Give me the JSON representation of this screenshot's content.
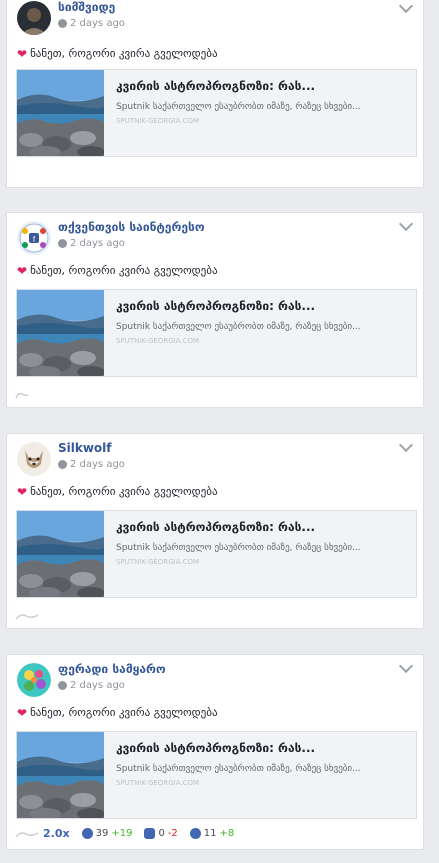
{
  "posts": [
    {
      "author": "სიმშვიდე",
      "time": "2 days ago",
      "text": "ნანეთ, როგორი კვირა გველოდება",
      "link": {
        "title": "კვირის ასტროპროგნოზი: რას...",
        "description": "Sputnik საქართველო ესაუბრობთ იმაზე, რაზეც სხვები...",
        "domain": "SPUTNIK-GEORGIA.COM"
      }
    },
    {
      "author": "თქვენთვის საინტერესო",
      "time": "2 days ago",
      "text": "ნანეთ, როგორი კვირა გველოდება",
      "link": {
        "title": "კვირის ასტროპროგნოზი: რას...",
        "description": "Sputnik საქართველო ესაუბრობთ იმაზე, რაზეც სხვები...",
        "domain": "SPUTNIK-GEORGIA.COM"
      }
    },
    {
      "author": "Silkwolf",
      "time": "2 days ago",
      "text": "ნანეთ, როგორი კვირა გველოდება",
      "link": {
        "title": "კვირის ასტროპროგნოზი: რას...",
        "description": "Sputnik საქართველო ესაუბრობთ იმაზე, რაზეც სხვები...",
        "domain": "SPUTNIK-GEORGIA.COM"
      }
    },
    {
      "author": "ფერადი სამყარო",
      "time": "2 days ago",
      "text": "ნანეთ, როგორი კვირა გველოდება",
      "link": {
        "title": "კვირის ასტროპროგნოზი: რას...",
        "description": "Sputnik საქართველო ესაუბრობთ იმაზე, რაზეც სხვები...",
        "domain": "SPUTNIK-GEORGIA.COM"
      },
      "stats": {
        "multiplier": "2.0x",
        "reactions": "39",
        "reactions_delta": "+19",
        "comments": "0",
        "comments_delta": "-2",
        "shares": "11",
        "shares_delta": "+8"
      }
    }
  ],
  "colors": {
    "accent": "#4267b2",
    "positive": "#42b72a",
    "negative": "#e02424",
    "heart": "#e0245e"
  },
  "icons": [
    "globe-icon",
    "chevron-down-icon",
    "heart-icon",
    "reaction-icon",
    "comment-icon",
    "share-icon",
    "trend-sparkline-icon"
  ]
}
